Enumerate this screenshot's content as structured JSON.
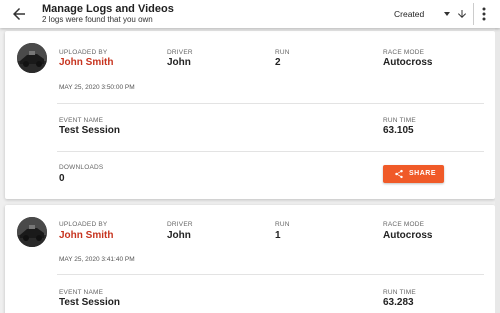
{
  "header": {
    "title": "Manage Logs and Videos",
    "subtitle": "2 logs were found that you own",
    "sort_selected": "Created"
  },
  "labels": {
    "uploaded_by": "UPLOADED BY",
    "driver": "DRIVER",
    "run": "RUN",
    "race_mode": "RACE MODE",
    "event_name": "EVENT NAME",
    "run_time": "RUN TIME",
    "downloads": "DOWNLOADS",
    "share": "SHARE"
  },
  "logs": [
    {
      "uploaded_by": "John Smith",
      "driver": "John",
      "run": "2",
      "race_mode": "Autocross",
      "date": "MAY 25, 2020 3:50:00 PM",
      "event_name": "Test Session",
      "run_time": "63.105",
      "downloads": "0"
    },
    {
      "uploaded_by": "John Smith",
      "driver": "John",
      "run": "1",
      "race_mode": "Autocross",
      "date": "MAY 25, 2020 3:41:40 PM",
      "event_name": "Test Session",
      "run_time": "63.283"
    }
  ],
  "colors": {
    "accent": "#f05a28",
    "name_red": "#c7341f"
  }
}
